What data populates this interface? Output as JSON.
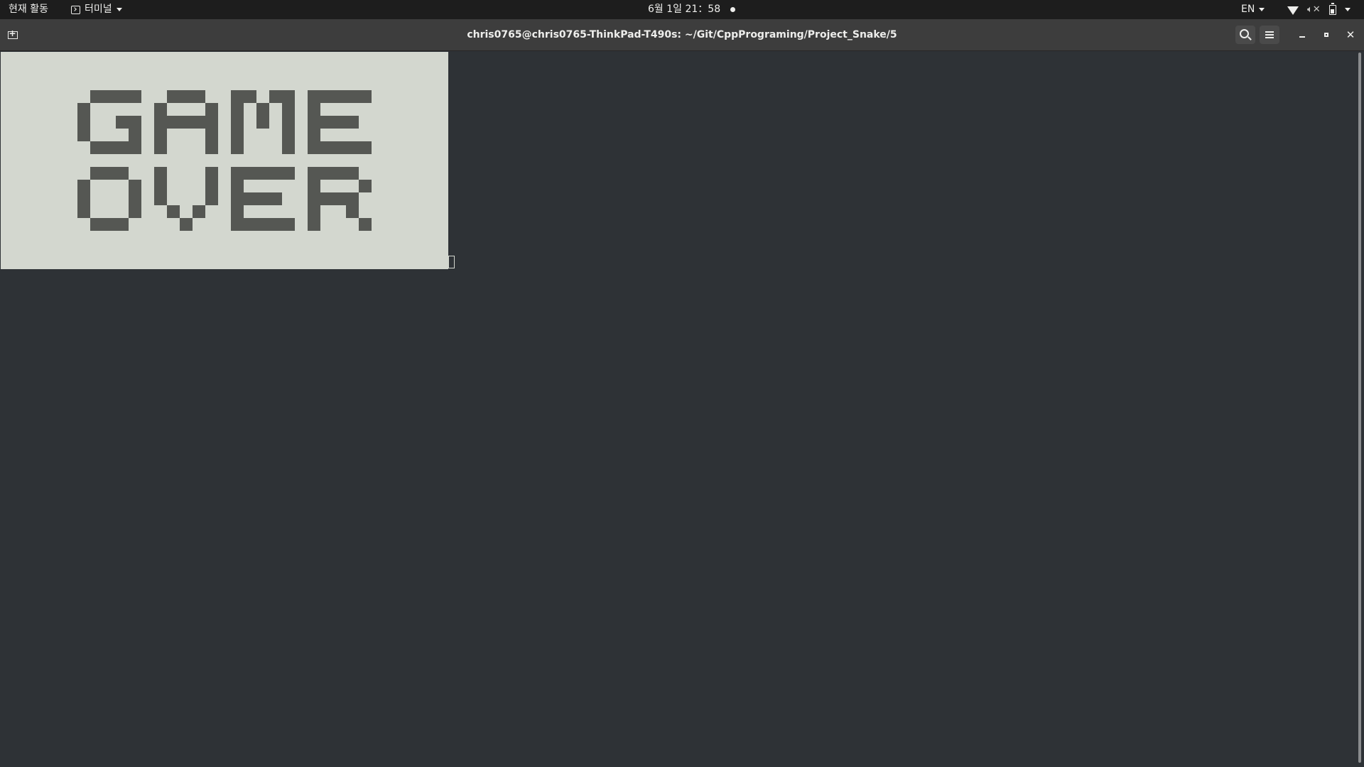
{
  "topbar": {
    "activities_label": "현재 활동",
    "app_menu_label": "터미널",
    "clock_label": "6월 1일  21：58",
    "language_label": "EN"
  },
  "headerbar": {
    "title": "chris0765@chris0765-ThinkPad-T490s: ~/Git/CppPrograming/Project_Snake/5"
  },
  "icons": {
    "new_tab": "new-tab-icon",
    "search": "search-icon",
    "menu": "hamburger-icon",
    "minimize": "minimize-icon",
    "maximize": "maximize-icon",
    "close": "close-icon",
    "wifi": "wifi-icon",
    "volume": "volume-muted-icon",
    "battery": "battery-icon",
    "power_menu": "chevron-down-icon"
  },
  "game": {
    "message": "GAME OVER",
    "panel_color": "#d3d7cf",
    "pixel_color": "#555753",
    "background_color": "#2e3236"
  }
}
